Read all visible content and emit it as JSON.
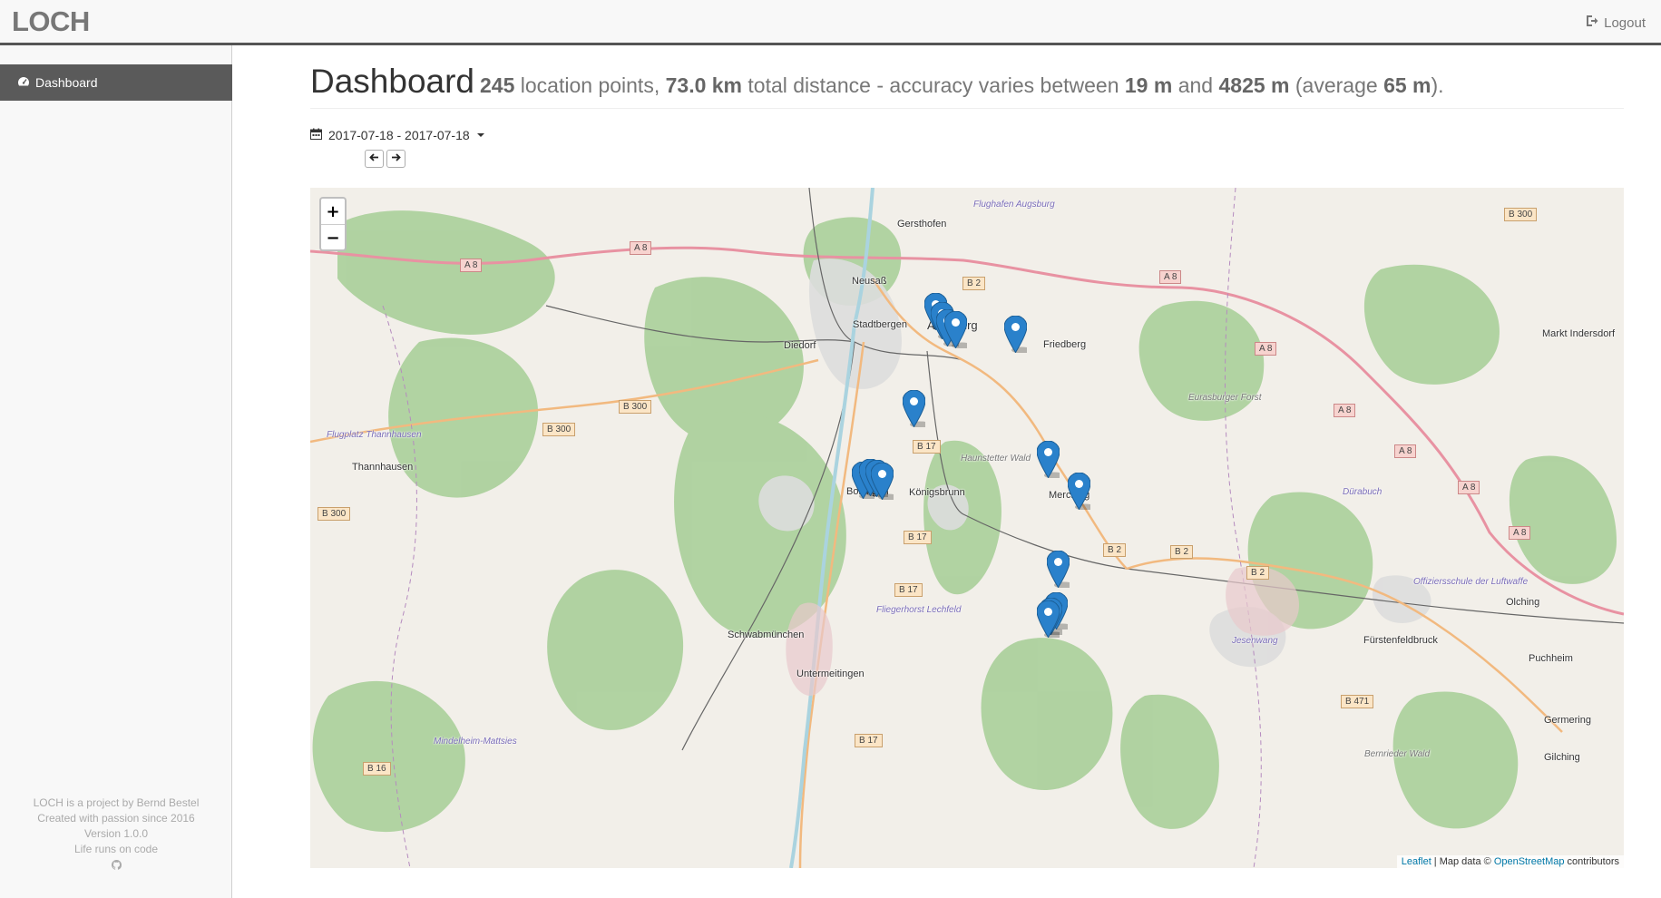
{
  "navbar": {
    "brand": "LOCH",
    "logout_label": "Logout"
  },
  "sidebar": {
    "items": [
      {
        "label": "Dashboard",
        "icon": "dashboard-icon",
        "active": true
      }
    ],
    "footer": {
      "line1": "LOCH is a project by Bernd Bestel",
      "line2": "Created with passion since 2016",
      "line3": "Version 1.0.0",
      "line4": "Life runs on code"
    }
  },
  "header": {
    "title": "Dashboard",
    "points_count": "245",
    "points_text": " location points, ",
    "distance": "73.0 km",
    "distance_text": " total distance - accuracy varies between ",
    "acc_min": "19 m",
    "and_text": " and ",
    "acc_max": "4825 m",
    "avg_open": " (average ",
    "acc_avg": "65 m",
    "avg_close": ")."
  },
  "date_range": {
    "value": "2017-07-18 - 2017-07-18",
    "prev_icon": "arrow-left-icon",
    "next_icon": "arrow-right-icon"
  },
  "map": {
    "zoom_in": "+",
    "zoom_out": "−",
    "attribution": {
      "leaflet": "Leaflet",
      "sep": " | Map data © ",
      "osm": "OpenStreetMap",
      "contributors": " contributors"
    },
    "places": [
      {
        "name": "Gersthofen"
      },
      {
        "name": "Flughafen Augsburg"
      },
      {
        "name": "Neusaß"
      },
      {
        "name": "Stadtbergen"
      },
      {
        "name": "Augsburg"
      },
      {
        "name": "Friedberg"
      },
      {
        "name": "Diedorf"
      },
      {
        "name": "Markt Indersdorf"
      },
      {
        "name": "Eurasburger Forst"
      },
      {
        "name": "Flugplatz Thannhausen"
      },
      {
        "name": "Thannhausen"
      },
      {
        "name": "Haunstetter Wald"
      },
      {
        "name": "Bobingen"
      },
      {
        "name": "Königsbrunn"
      },
      {
        "name": "Merching"
      },
      {
        "name": "Dürabuch"
      },
      {
        "name": "Offiziersschule der Luftwaffe"
      },
      {
        "name": "Olching"
      },
      {
        "name": "Fliegerhorst Lechfeld"
      },
      {
        "name": "Schwabmünchen"
      },
      {
        "name": "Jesenwang"
      },
      {
        "name": "Fürstenfeldbruck"
      },
      {
        "name": "Puchheim"
      },
      {
        "name": "Untermeitingen"
      },
      {
        "name": "Germering"
      },
      {
        "name": "Mindelheim-Mattsies"
      },
      {
        "name": "Bernrieder Wald"
      },
      {
        "name": "Gilching"
      }
    ],
    "roads": [
      "A 8",
      "B 2",
      "B 300",
      "B 17",
      "B 471",
      "B 16"
    ],
    "markers_count": 16
  }
}
